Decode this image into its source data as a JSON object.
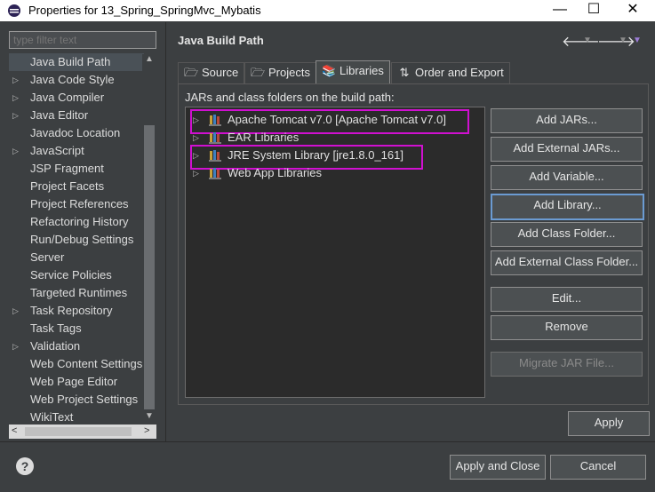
{
  "window": {
    "title": "Properties for 13_Spring_SpringMvc_Mybatis",
    "minimize": "—",
    "maximize": "☐",
    "close": "✕"
  },
  "filter": {
    "placeholder": "type filter text"
  },
  "nav_tree": {
    "items": [
      {
        "label": "Java Build Path",
        "expandable": false,
        "selected": true
      },
      {
        "label": "Java Code Style",
        "expandable": true
      },
      {
        "label": "Java Compiler",
        "expandable": true
      },
      {
        "label": "Java Editor",
        "expandable": true
      },
      {
        "label": "Javadoc Location",
        "expandable": false
      },
      {
        "label": "JavaScript",
        "expandable": true
      },
      {
        "label": "JSP Fragment",
        "expandable": false
      },
      {
        "label": "Project Facets",
        "expandable": false
      },
      {
        "label": "Project References",
        "expandable": false
      },
      {
        "label": "Refactoring History",
        "expandable": false
      },
      {
        "label": "Run/Debug Settings",
        "expandable": false
      },
      {
        "label": "Server",
        "expandable": false
      },
      {
        "label": "Service Policies",
        "expandable": false
      },
      {
        "label": "Targeted Runtimes",
        "expandable": false
      },
      {
        "label": "Task Repository",
        "expandable": true
      },
      {
        "label": "Task Tags",
        "expandable": false
      },
      {
        "label": "Validation",
        "expandable": true
      },
      {
        "label": "Web Content Settings",
        "expandable": false
      },
      {
        "label": "Web Page Editor",
        "expandable": false
      },
      {
        "label": "Web Project Settings",
        "expandable": false
      },
      {
        "label": "WikiText",
        "expandable": false
      }
    ]
  },
  "page": {
    "title": "Java Build Path"
  },
  "tabs": [
    {
      "label": "Source",
      "active": false
    },
    {
      "label": "Projects",
      "active": false
    },
    {
      "label": "Libraries",
      "active": true
    },
    {
      "label": "Order and Export",
      "active": false
    }
  ],
  "libraries": {
    "caption": "JARs and class folders on the build path:",
    "items": [
      {
        "label": "Apache Tomcat v7.0 [Apache Tomcat v7.0]",
        "highlighted": true
      },
      {
        "label": "EAR Libraries",
        "highlighted": false
      },
      {
        "label": "JRE System Library [jre1.8.0_161]",
        "highlighted": true
      },
      {
        "label": "Web App Libraries",
        "highlighted": false
      }
    ]
  },
  "buttons": {
    "add_jars": "Add JARs...",
    "add_external_jars": "Add External JARs...",
    "add_variable": "Add Variable...",
    "add_library": "Add Library...",
    "add_class_folder": "Add Class Folder...",
    "add_external_class_folder": "Add External Class Folder...",
    "edit": "Edit...",
    "remove": "Remove",
    "migrate_jar": "Migrate JAR File...",
    "apply": "Apply",
    "apply_and_close": "Apply and Close",
    "cancel": "Cancel"
  },
  "colors": {
    "background": "#3c3f41",
    "list_background": "#2b2b2b",
    "highlight_border": "#d010d0",
    "focus_border": "#6b9bd2"
  }
}
